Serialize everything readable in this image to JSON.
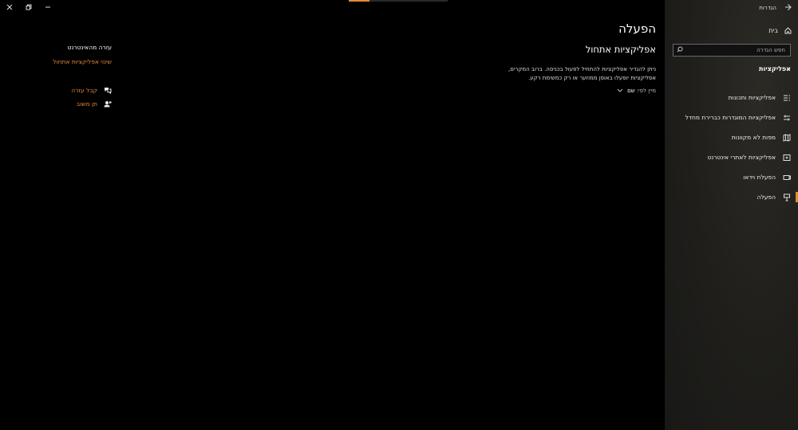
{
  "window": {
    "title": "הגדרות",
    "controls": [
      "minimize",
      "restore",
      "close"
    ]
  },
  "sidebar": {
    "home_label": "בית",
    "search_placeholder": "חפש הגדרה",
    "section_title": "אפליקציות",
    "items": [
      {
        "label": "אפליקציות ותכונות",
        "icon": "apps-list-icon"
      },
      {
        "label": "אפליקציות המוגדרות כברירת מחדל",
        "icon": "default-apps-icon"
      },
      {
        "label": "מפות לא מקוונות",
        "icon": "offline-maps-icon"
      },
      {
        "label": "אפליקציות לאתרי אינטרנט",
        "icon": "apps-for-websites-icon"
      },
      {
        "label": "הפעלת וידאו",
        "icon": "video-playback-icon"
      },
      {
        "label": "הפעלה",
        "icon": "startup-icon",
        "active": true
      }
    ]
  },
  "main": {
    "page_title": "הפעלה",
    "subtitle": "אפליקציות אתחול",
    "description_line1": "ניתן להגדיר אפליקציות להתחיל לפעול בכניסה. ברוב המקרים,",
    "description_line2": "אפליקציות יופעלו באופן ממוזער או רק כמשימת רקע.",
    "sort_label": "מיין לפי:",
    "sort_value": "שם"
  },
  "help": {
    "title": "עזרה מהאינטרנט",
    "link": "שינוי אפליקציות אתחול",
    "get_help": "קבל עזרה",
    "give_feedback": "תן משוב"
  },
  "colors": {
    "accent": "#e58a34",
    "background": "#000000",
    "sidebar": "#1f1e1b"
  }
}
